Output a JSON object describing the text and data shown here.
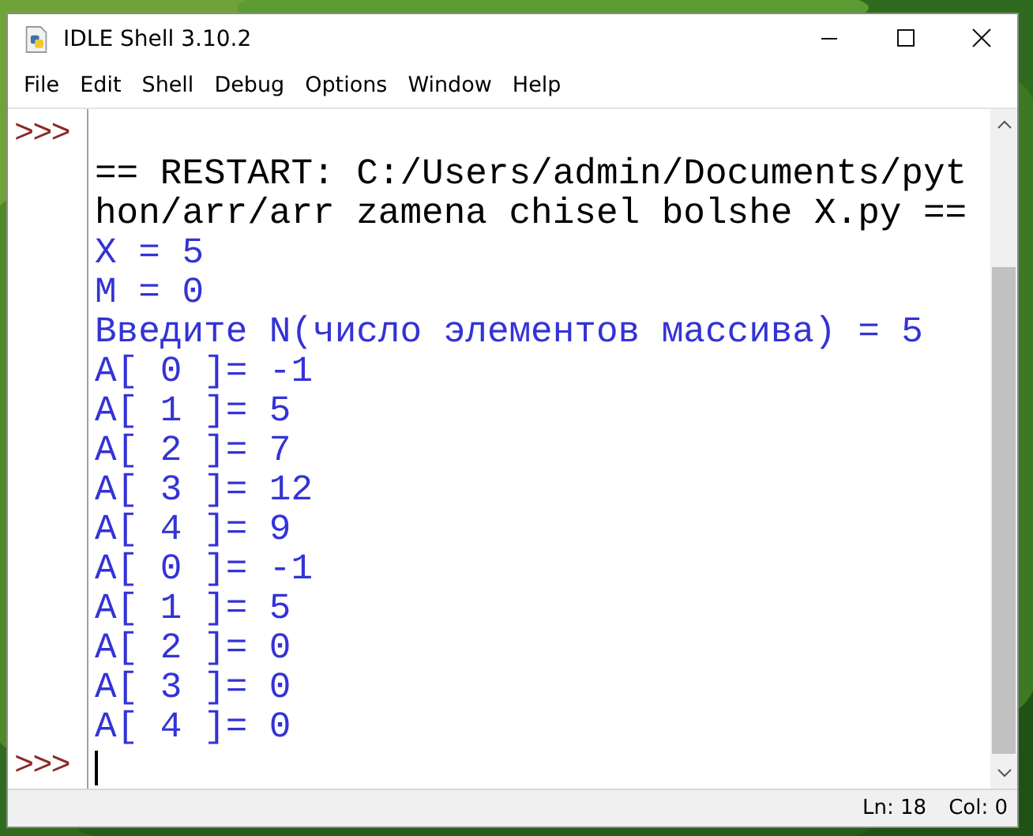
{
  "window": {
    "title": "IDLE Shell 3.10.2"
  },
  "menu": [
    "File",
    "Edit",
    "Shell",
    "Debug",
    "Options",
    "Window",
    "Help"
  ],
  "shell": {
    "lines": [
      {
        "prompt": ">>>"
      },
      {
        "kind": "restart",
        "text": "== RESTART: C:/Users/admin/Documents/pyt"
      },
      {
        "kind": "restart",
        "text": "hon/arr/arr zamena chisel bolshe X.py =="
      },
      {
        "kind": "output",
        "text": "X = 5"
      },
      {
        "kind": "output",
        "text": "M = 0"
      },
      {
        "kind": "output",
        "text": "Введите N(число элементов массива) = 5"
      },
      {
        "kind": "output",
        "text": "A[ 0 ]= -1"
      },
      {
        "kind": "output",
        "text": "A[ 1 ]= 5"
      },
      {
        "kind": "output",
        "text": "A[ 2 ]= 7"
      },
      {
        "kind": "output",
        "text": "A[ 3 ]= 12"
      },
      {
        "kind": "output",
        "text": "A[ 4 ]= 9"
      },
      {
        "kind": "output",
        "text": "A[ 0 ]= -1"
      },
      {
        "kind": "output",
        "text": "A[ 1 ]= 5"
      },
      {
        "kind": "output",
        "text": "A[ 2 ]= 0"
      },
      {
        "kind": "output",
        "text": "A[ 3 ]= 0"
      },
      {
        "kind": "output",
        "text": "A[ 4 ]= 0"
      },
      {
        "prompt": ">>>",
        "cursor": true
      }
    ]
  },
  "status_bar": {
    "line": "Ln: 18",
    "col": "Col: 0"
  }
}
